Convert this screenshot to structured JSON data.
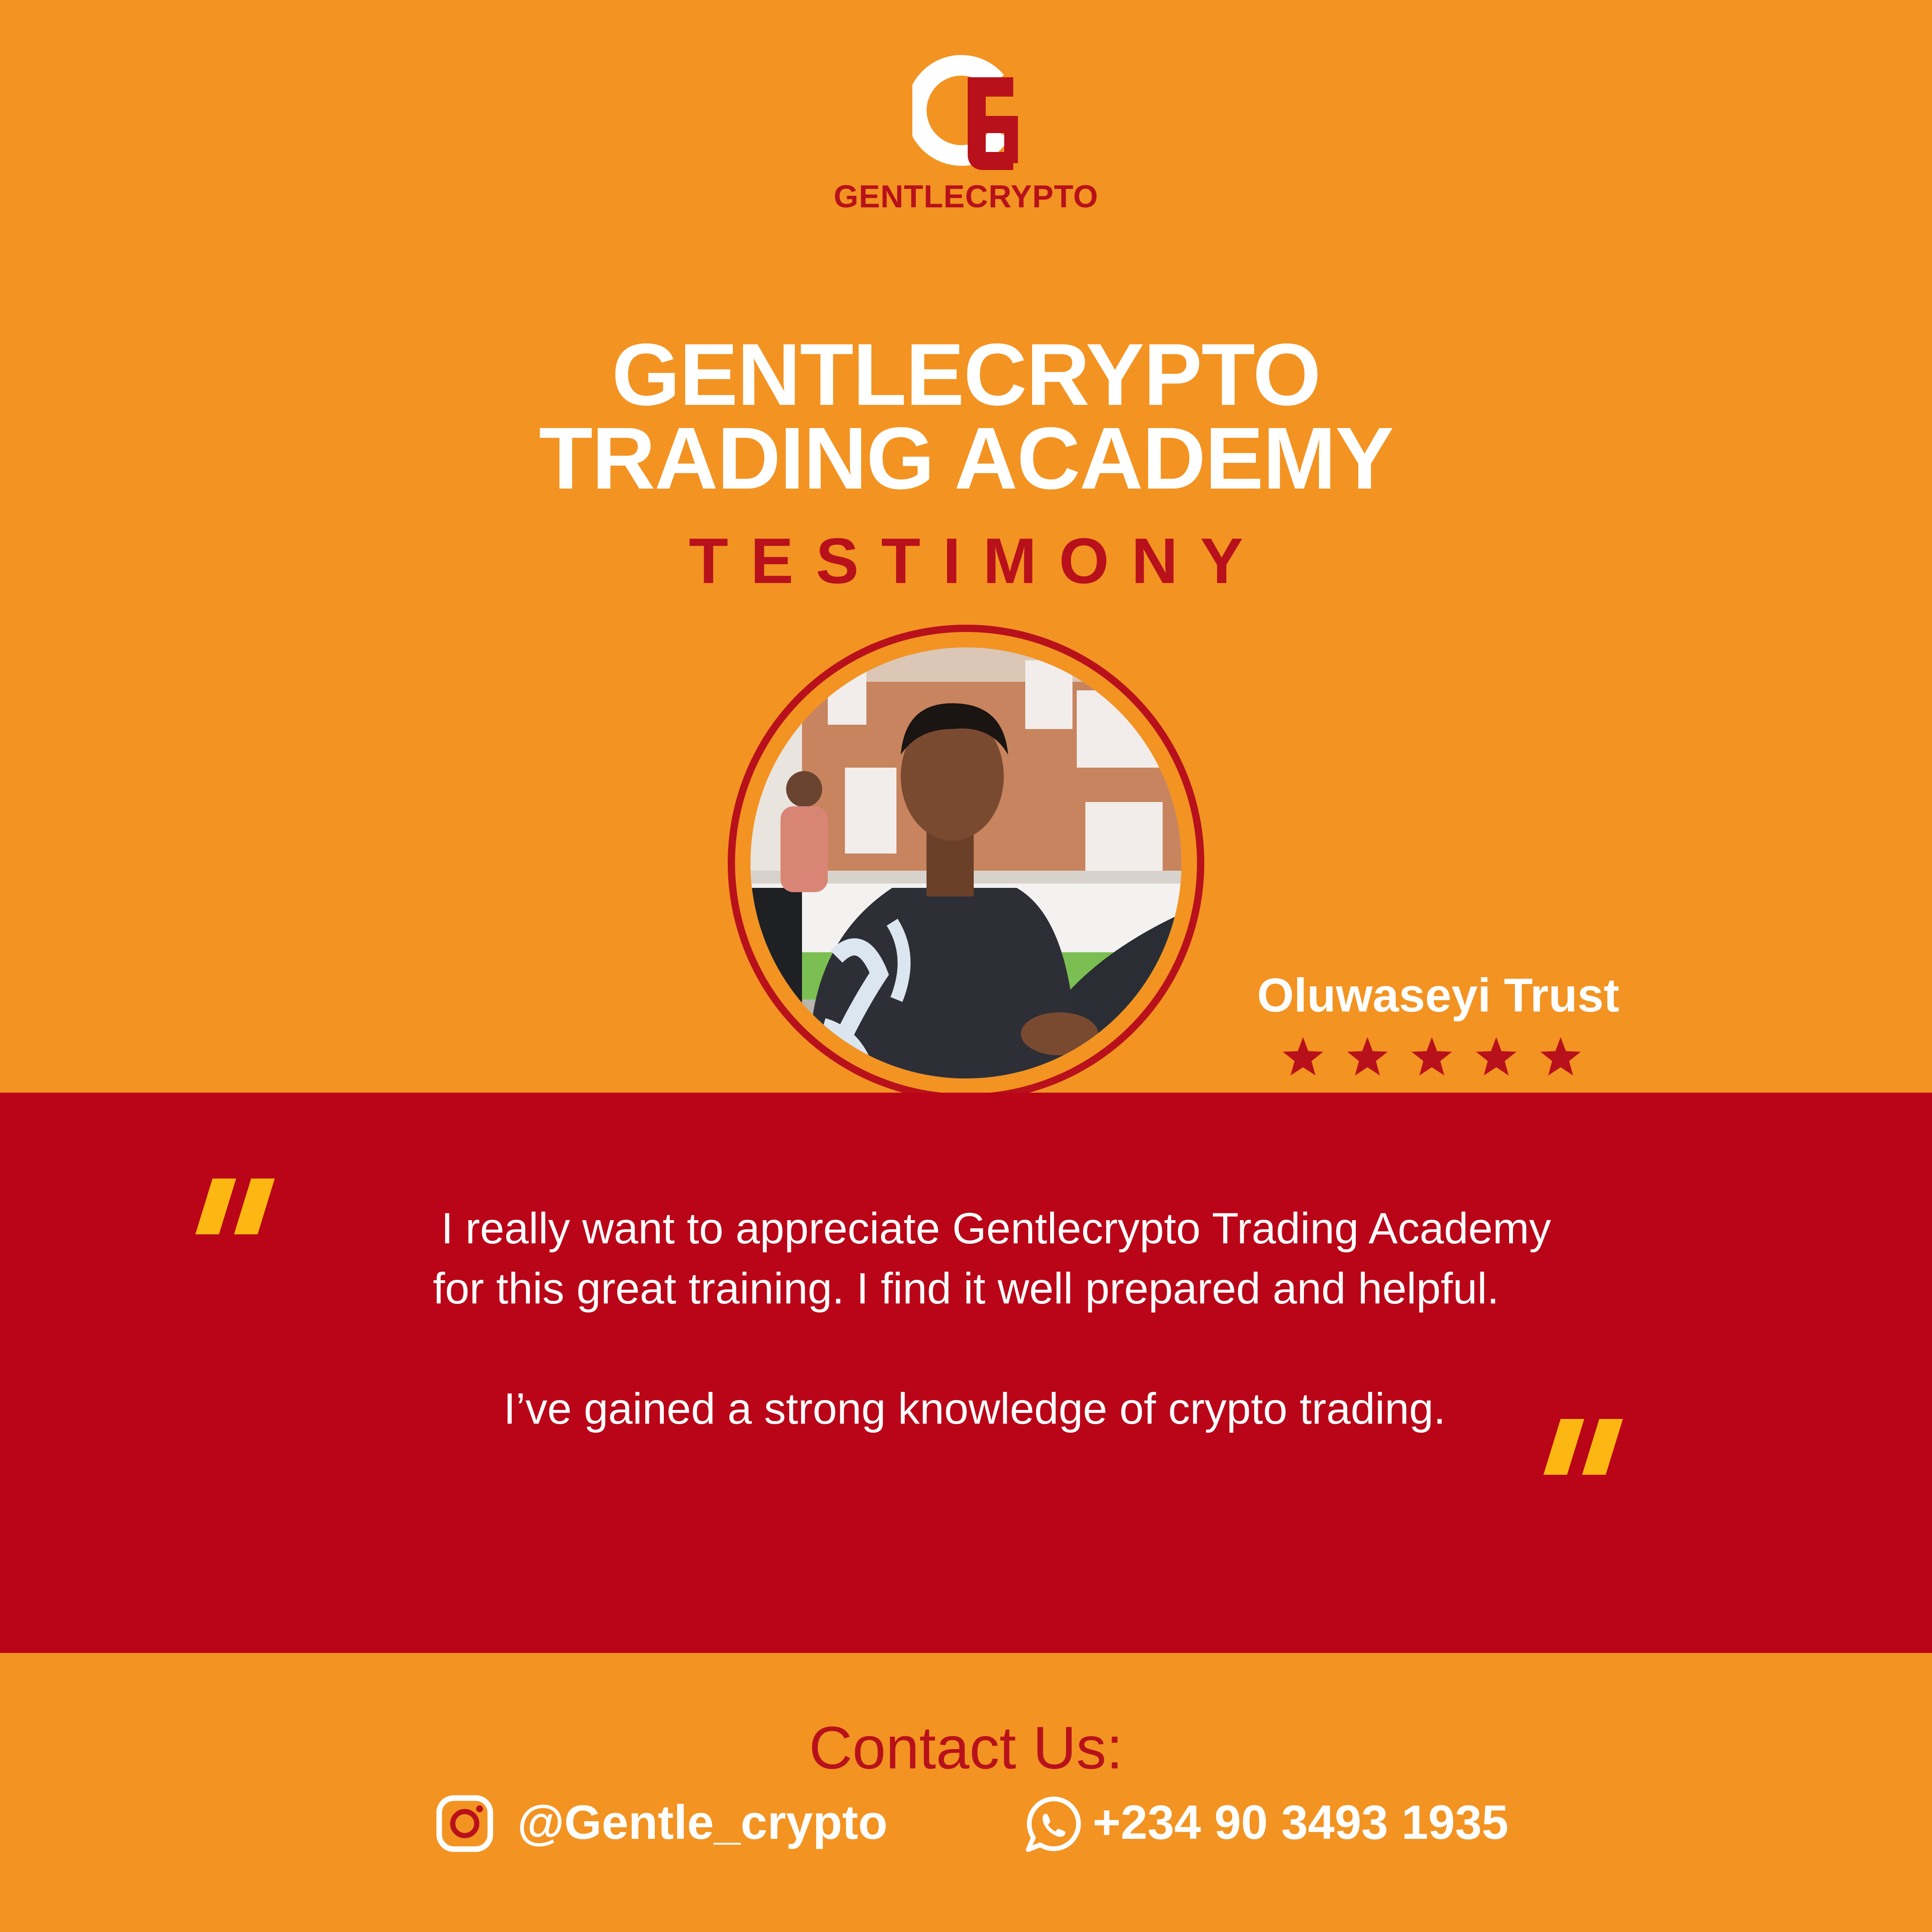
{
  "brand": {
    "name": "GENTLECRYPTO",
    "logo_letter": "G"
  },
  "header": {
    "title_line_1": "GENTLECRYPTO",
    "title_line_2": "TRADING ACADEMY",
    "subtitle": "TESTIMONY"
  },
  "reviewer": {
    "name": "Oluwaseyi Trust",
    "rating": 5,
    "rating_max": 5
  },
  "testimonial": {
    "line_1": "I really want to appreciate Gentlecrypto Trading Academy",
    "line_2": "for this great training. I find it well prepared and helpful.",
    "line_3": "I’ve gained a strong knowledge of crypto trading."
  },
  "contact": {
    "heading": "Contact Us:",
    "instagram_icon": "instagram-icon",
    "instagram": "@Gentle_crypto",
    "whatsapp_icon": "whatsapp-icon",
    "phone": "+234 90 3493 1935"
  },
  "colors": {
    "background": "#F39322",
    "brand_red": "#B8111B",
    "band_red": "#BA0518",
    "quote_mark": "#FCB712",
    "text_white": "#FFFFFF"
  }
}
